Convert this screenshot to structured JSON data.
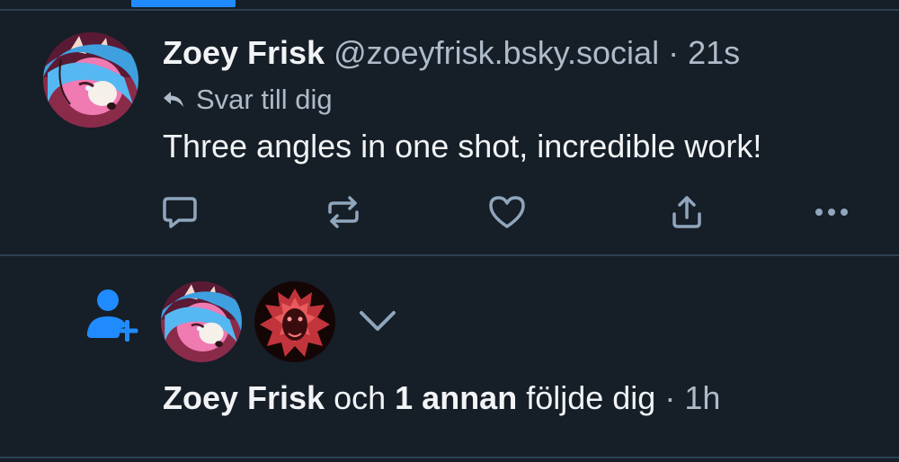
{
  "colors": {
    "background": "#161e27",
    "divider": "#2e4052",
    "accent": "#208bfe",
    "text_primary": "#f1f3f5",
    "text_secondary": "#aebbc9"
  },
  "post": {
    "author_name": "Zoey Frisk",
    "author_handle": "@zoeyfrisk.bsky.social",
    "separator": "·",
    "time": "21s",
    "reply_label": "Svar till dig",
    "text": "Three angles in one shot, incredible work!",
    "avatar_icon": "fox-character-avatar",
    "actions": [
      {
        "name": "reply-icon"
      },
      {
        "name": "repost-icon"
      },
      {
        "name": "like-icon"
      },
      {
        "name": "share-icon"
      },
      {
        "name": "more-icon"
      }
    ]
  },
  "notification": {
    "icon": "person-add-icon",
    "avatars": [
      "fox-character-avatar",
      "red-lion-avatar"
    ],
    "expand_icon": "chevron-down-icon",
    "actor_name": "Zoey Frisk",
    "conjunction": "och",
    "others": "1 annan",
    "action_text": "följde dig",
    "separator": "·",
    "time": "1h"
  }
}
